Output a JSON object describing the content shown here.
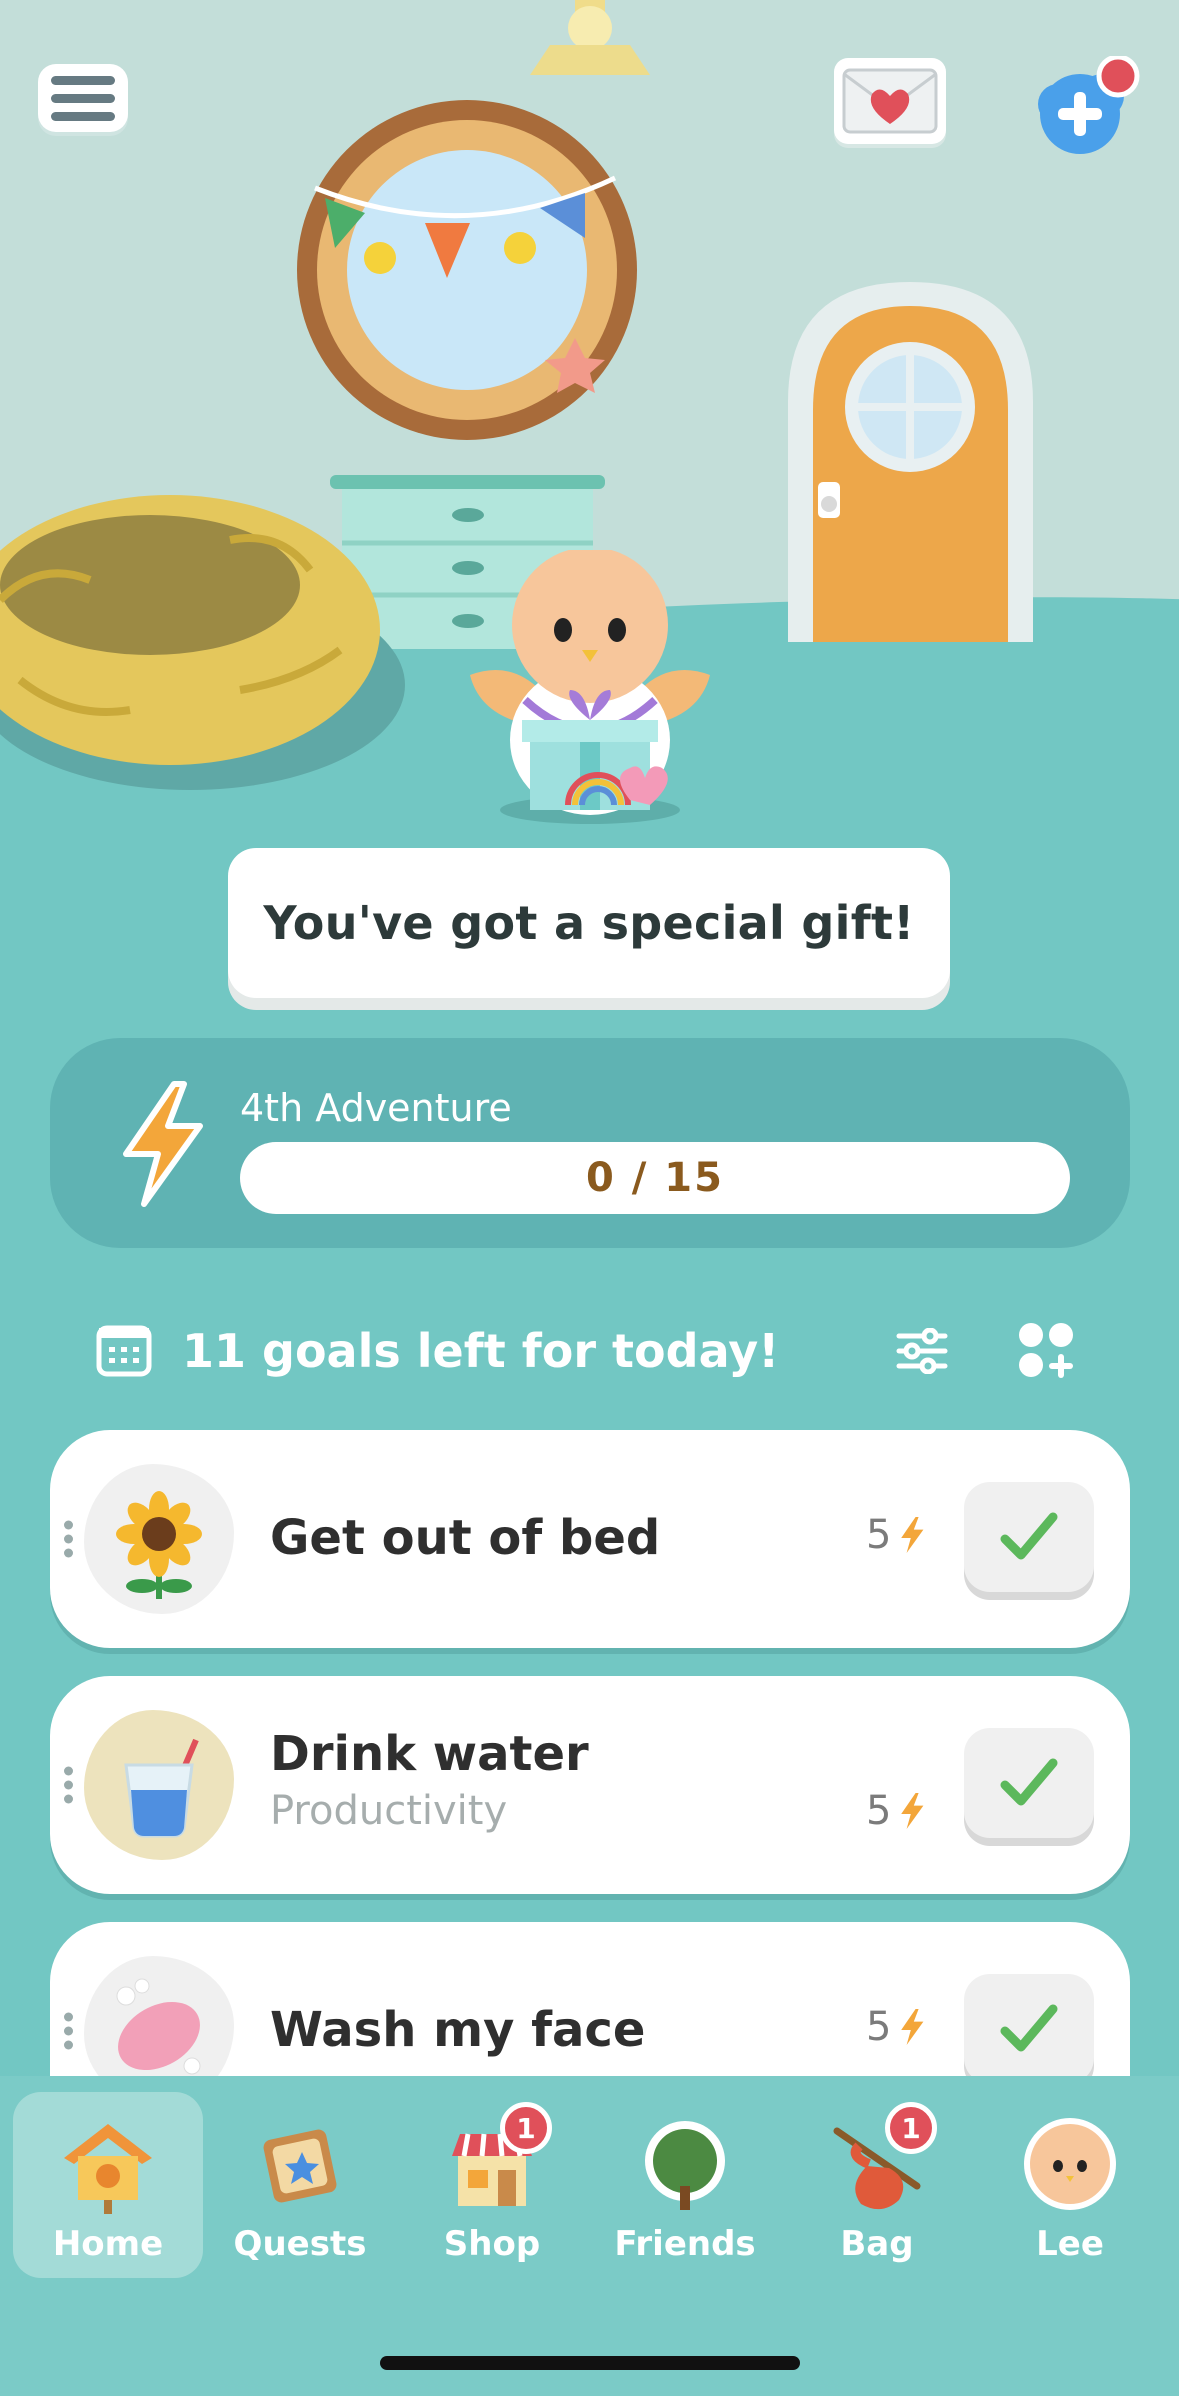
{
  "header": {
    "menu_icon": "hamburger-menu-icon",
    "mail_icon": "heart-mail-icon",
    "add_friend_icon": "add-friend-icon"
  },
  "gift_banner": {
    "text": "You've got a special gift!"
  },
  "adventure": {
    "title": "4th Adventure",
    "progress_text": "0 / 15",
    "progress_fraction": 0
  },
  "goals": {
    "header": "11 goals left for today!",
    "items": [
      {
        "name": "Get out of bed",
        "subtitle": "",
        "points": "5",
        "icon": "sunflower-icon"
      },
      {
        "name": "Drink water",
        "subtitle": "Productivity",
        "points": "5",
        "icon": "water-glass-icon"
      },
      {
        "name": "Wash my face",
        "subtitle": "",
        "points": "5",
        "icon": "soap-icon"
      }
    ]
  },
  "tabs": [
    {
      "label": "Home",
      "badge": ""
    },
    {
      "label": "Quests",
      "badge": ""
    },
    {
      "label": "Shop",
      "badge": "1"
    },
    {
      "label": "Friends",
      "badge": ""
    },
    {
      "label": "Bag",
      "badge": "1"
    },
    {
      "label": "Lee",
      "badge": ""
    }
  ],
  "colors": {
    "background": "#72c7c3",
    "accent_orange": "#f3a63a",
    "check_green": "#5cb85c",
    "badge_red": "#e0505a"
  }
}
